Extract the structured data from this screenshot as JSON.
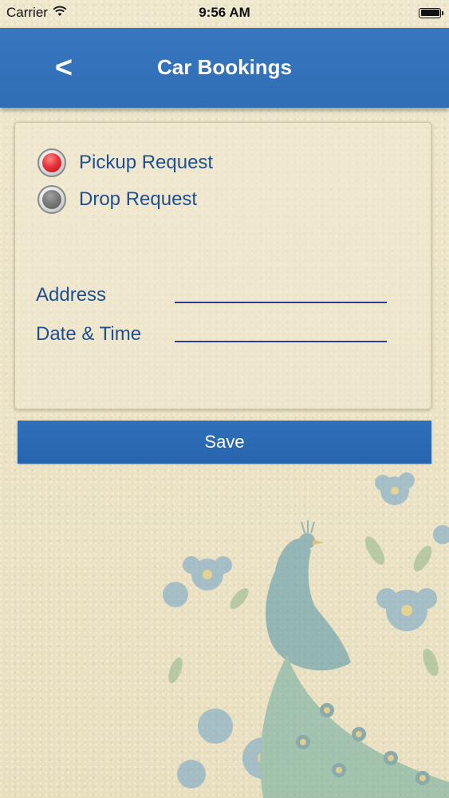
{
  "status_bar": {
    "carrier": "Carrier",
    "time": "9:56 AM",
    "wifi_icon": "wifi-icon",
    "battery_icon": "battery-icon"
  },
  "nav": {
    "back_label": "<",
    "title": "Car Bookings"
  },
  "request_type": {
    "options": [
      {
        "label": "Pickup Request",
        "selected": true,
        "color": "#e8353b"
      },
      {
        "label": "Drop Request",
        "selected": false,
        "color": "#777777"
      }
    ]
  },
  "form": {
    "address_label": "Address",
    "address_value": "",
    "datetime_label": "Date & Time",
    "datetime_value": ""
  },
  "save_label": "Save",
  "colors": {
    "nav_blue": "#2f6db5",
    "label_blue": "#1f4f93",
    "background": "#ece4c8"
  }
}
